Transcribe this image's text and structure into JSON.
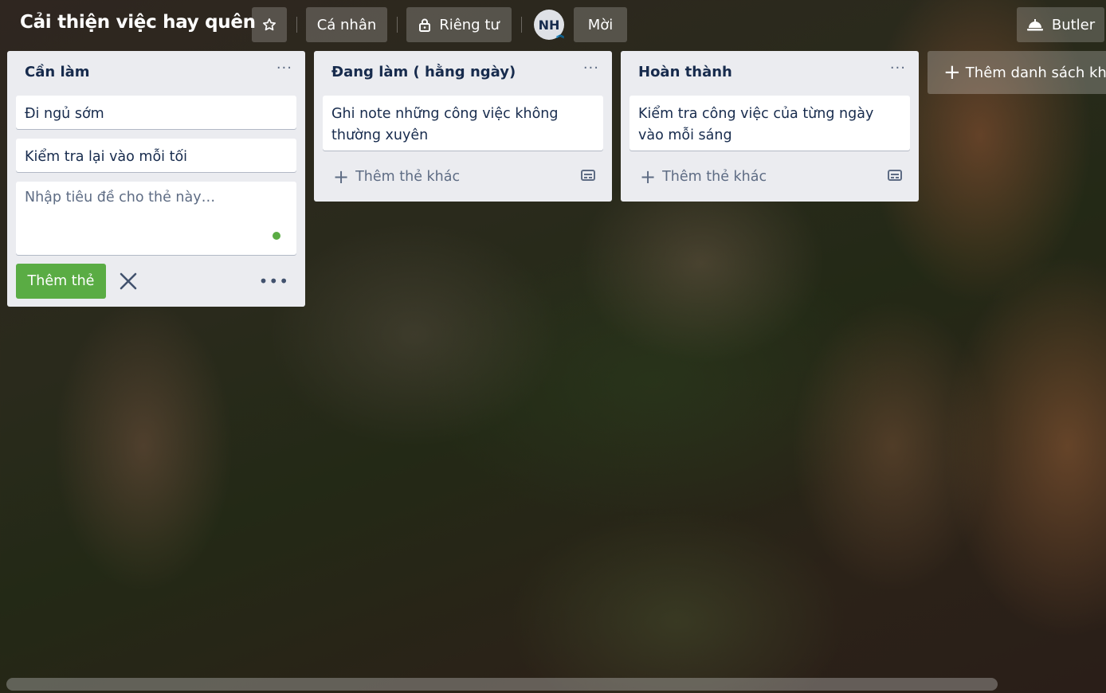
{
  "header": {
    "board_title": "Cải thiện việc hay quên",
    "star_icon": "star-icon",
    "personal_label": "Cá nhân",
    "private_label": "Riêng tư",
    "avatar_initials": "NH",
    "invite_label": "Mời",
    "butler_label": "Butler"
  },
  "lists": [
    {
      "title": "Cần làm",
      "menu": "···",
      "cards": [
        "Đi ngủ sớm",
        "Kiểm tra lại vào mỗi tối"
      ],
      "composer": {
        "placeholder": "Nhập tiêu đề cho thẻ này…",
        "add_button": "Thêm thẻ",
        "more": "•••"
      }
    },
    {
      "title": "Đang làm ( hằng ngày)",
      "menu": "···",
      "cards": [
        "Ghi note những công việc không thường xuyên"
      ],
      "add_another": "Thêm thẻ khác"
    },
    {
      "title": "Hoàn thành",
      "menu": "···",
      "cards": [
        "Kiểm tra công việc của từng ngày vào mỗi sáng"
      ],
      "add_another": "Thêm thẻ khác"
    }
  ],
  "add_list_label": "Thêm danh sách khác",
  "colors": {
    "list_bg": "#ebecf0",
    "add_button": "#5aac44",
    "text": "#172b4d",
    "muted": "#5e6c84"
  }
}
